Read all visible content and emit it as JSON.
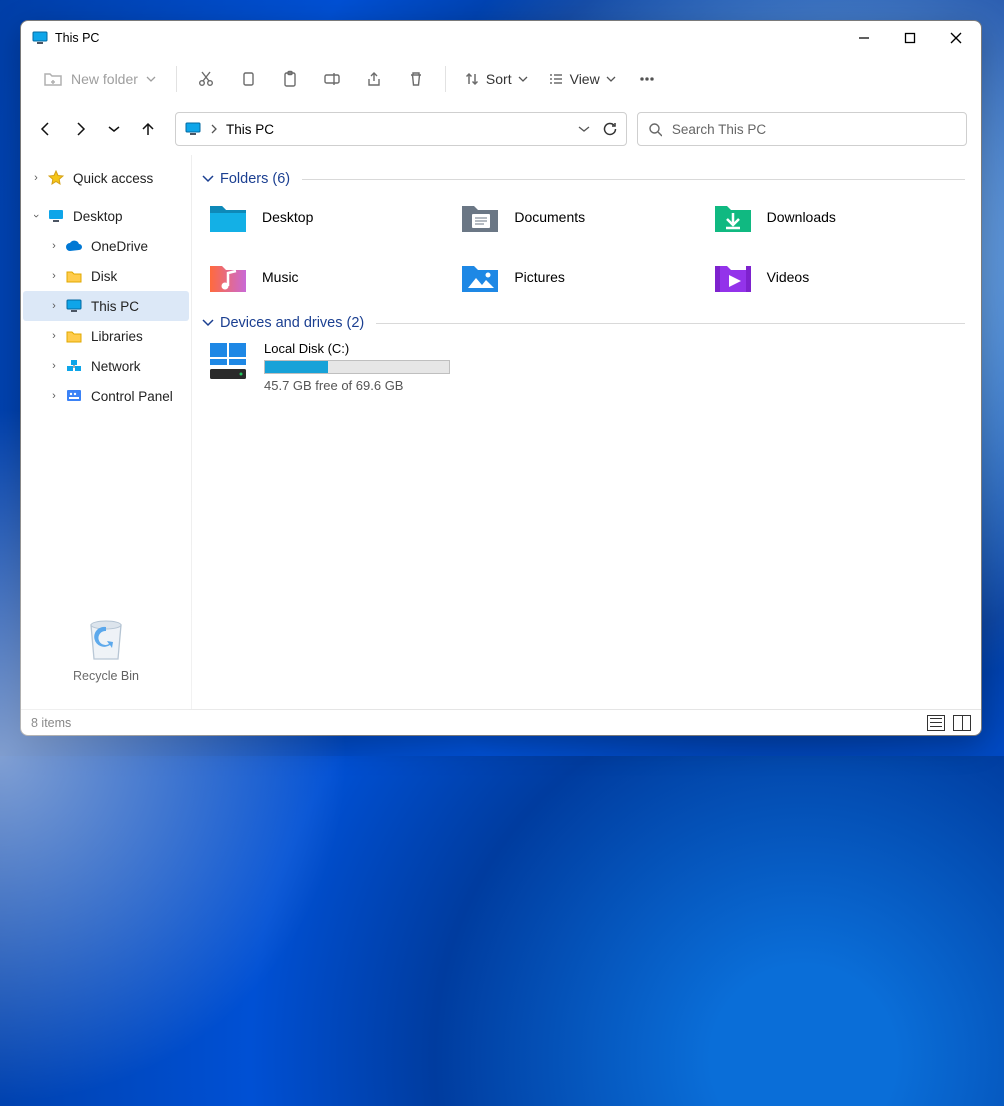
{
  "title": "This PC",
  "toolbar": {
    "new_folder": "New folder",
    "sort": "Sort",
    "view": "View"
  },
  "address": {
    "crumb": "This PC"
  },
  "search": {
    "placeholder": "Search This PC"
  },
  "sidebar": {
    "quick_access": "Quick access",
    "desktop": "Desktop",
    "onedrive": "OneDrive",
    "disk": "Disk",
    "this_pc": "This PC",
    "libraries": "Libraries",
    "network": "Network",
    "control_panel": "Control Panel",
    "recycle_bin": "Recycle Bin"
  },
  "groups": {
    "folders": {
      "label": "Folders (6)"
    },
    "devices": {
      "label": "Devices and drives (2)"
    }
  },
  "folders": {
    "desktop": "Desktop",
    "documents": "Documents",
    "downloads": "Downloads",
    "music": "Music",
    "pictures": "Pictures",
    "videos": "Videos"
  },
  "drive": {
    "name": "Local Disk (C:)",
    "free_text": "45.7 GB free of 69.6 GB",
    "used_percent": 34
  },
  "status": {
    "items": "8 items"
  }
}
